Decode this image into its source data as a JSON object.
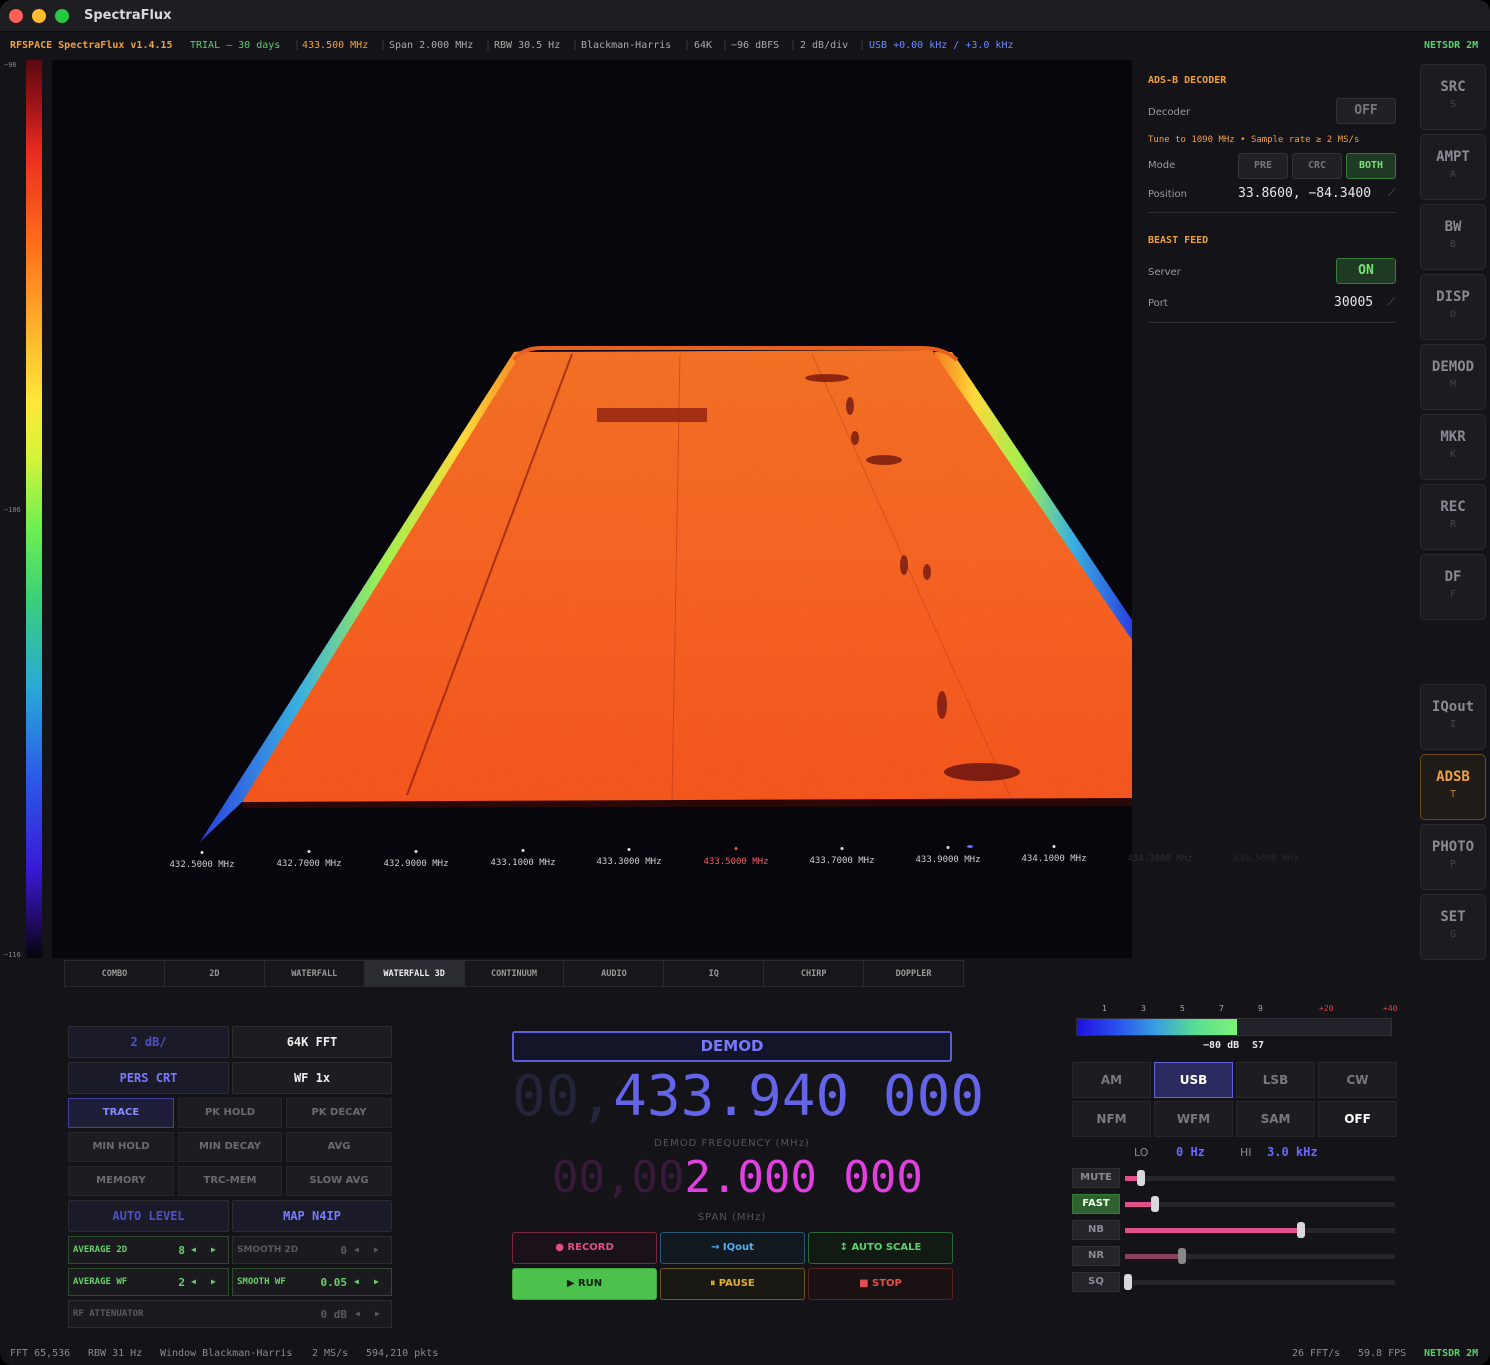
{
  "window": {
    "title": "SpectraFlux"
  },
  "status": {
    "app": "RFSPACE SpectraFlux v1.4.15",
    "trial": "TRIAL — 30 days",
    "freq": "433.500 MHz",
    "span": "Span 2.000 MHz",
    "rbw": "RBW 30.5 Hz",
    "window": "Blackman-Harris",
    "fft": "64K",
    "ref": "−96 dBFS",
    "scale": "2 dB/div",
    "demod": "USB +0.00 kHz / +3.0 kHz",
    "device": "NETSDR 2M"
  },
  "colorbar": {
    "top": "−96",
    "mid": "−106",
    "bottom": "−116"
  },
  "freq_axis": [
    "432.5000 MHz",
    "432.7000 MHz",
    "432.9000 MHz",
    "433.1000 MHz",
    "433.3000 MHz",
    "433.5000 MHz",
    "433.7000 MHz",
    "433.9000 MHz",
    "434.1000 MHz",
    "434.3000 MHz",
    "434.5000 MHz"
  ],
  "tabs": [
    "COMBO",
    "2D",
    "WATERFALL",
    "WATERFALL 3D",
    "CONTINUUM",
    "AUDIO",
    "IQ",
    "CHIRP",
    "DOPPLER"
  ],
  "adsb": {
    "title": "ADS-B DECODER",
    "decoder_label": "Decoder",
    "decoder_value": "OFF",
    "hint": "Tune to 1090 MHz • Sample rate ≥ 2 MS/s",
    "mode_label": "Mode",
    "modes": [
      "PRE",
      "CRC",
      "BOTH"
    ],
    "position_label": "Position",
    "position_value": "33.8600, −84.3400"
  },
  "beast": {
    "title": "BEAST FEED",
    "server_label": "Server",
    "server_value": "ON",
    "port_label": "Port",
    "port_value": "30005"
  },
  "sidebar": [
    {
      "label": "SRC",
      "key": "S"
    },
    {
      "label": "AMPT",
      "key": "A"
    },
    {
      "label": "BW",
      "key": "B"
    },
    {
      "label": "DISP",
      "key": "D"
    },
    {
      "label": "DEMOD",
      "key": "M"
    },
    {
      "label": "MKR",
      "key": "K"
    },
    {
      "label": "REC",
      "key": "R"
    },
    {
      "label": "DF",
      "key": "F"
    },
    {
      "label": "IQout",
      "key": "I"
    },
    {
      "label": "ADSB",
      "key": "T"
    },
    {
      "label": "PHOTO",
      "key": "P"
    },
    {
      "label": "SET",
      "key": "G"
    }
  ],
  "display": {
    "db_div": "2 dB/",
    "fft_size": "64K FFT",
    "pers": "PERS CRT",
    "wf": "WF 1x",
    "trace": "TRACE",
    "pk_hold": "PK HOLD",
    "pk_decay": "PK DECAY",
    "min_hold": "MIN HOLD",
    "min_decay": "MIN DECAY",
    "avg": "AVG",
    "memory": "MEMORY",
    "trc_mem": "TRC-MEM",
    "slow_avg": "SLOW AVG",
    "auto_level": "AUTO LEVEL",
    "map": "MAP N4IP",
    "avg2d_label": "AVERAGE 2D",
    "avg2d_value": "8",
    "smooth2d_label": "SMOOTH 2D",
    "smooth2d_value": "0",
    "avgwf_label": "AVERAGE WF",
    "avgwf_value": "2",
    "smoothwf_label": "SMOOTH WF",
    "smoothwf_value": "0.05",
    "rfatt_label": "RF ATTENUATOR",
    "rfatt_value": "0 dB"
  },
  "demod": {
    "title": "DEMOD",
    "freq_dim": "00,",
    "freq_main": "433.940",
    "freq_tail": " 000",
    "freq_caption": "DEMOD FREQUENCY (MHz)",
    "span_dim": "00,00",
    "span_main": "2.000",
    "span_tail": " 000",
    "span_caption": "SPAN (MHz)"
  },
  "actions": {
    "record": "● RECORD",
    "iqout": "→ IQout",
    "autoscale": "↕ AUTO SCALE",
    "run": "▶ RUN",
    "pause": "⏸ PAUSE",
    "stop": "■ STOP"
  },
  "meter": {
    "scale": [
      "1",
      "3",
      "5",
      "7",
      "9",
      "+20",
      "+40"
    ],
    "level": 0.51,
    "db": "−80 dB",
    "s": "S7"
  },
  "modes": [
    "AM",
    "USB",
    "LSB",
    "CW",
    "NFM",
    "WFM",
    "SAM",
    "OFF"
  ],
  "filter": {
    "lo_label": "LO",
    "lo_value": "0 Hz",
    "hi_label": "HI",
    "hi_value": "3.0 kHz"
  },
  "sliders": [
    {
      "label": "MUTE",
      "value": 0.06
    },
    {
      "label": "FAST",
      "value": 0.11
    },
    {
      "label": "NB",
      "value": 0.65
    },
    {
      "label": "NR",
      "value": 0.21
    },
    {
      "label": "SQ",
      "value": 0.01
    }
  ],
  "footer": {
    "fft": "FFT 65,536",
    "rbw": "RBW 31 Hz",
    "window": "Window Blackman-Harris",
    "rate": "2 MS/s",
    "pkts": "594,210 pkts",
    "fft_rate": "26 FFT/s",
    "fps": "59.8 FPS",
    "device": "NETSDR 2M"
  },
  "colors": {
    "accent": "#f0a040",
    "demod": "#6464e8",
    "span": "#e040e0",
    "green": "#40c040"
  }
}
